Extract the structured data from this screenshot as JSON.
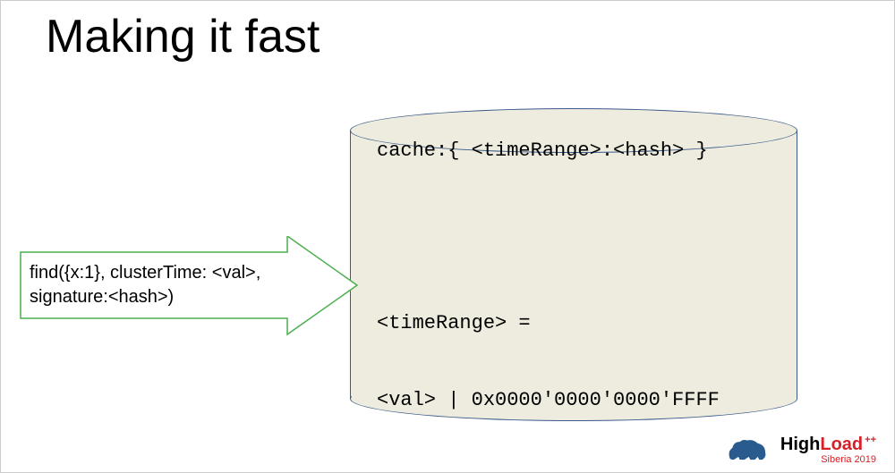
{
  "title": "Making it fast",
  "arrow": {
    "text": "find({x:1}, clusterTime: <val>, signature:<hash>)"
  },
  "cylinder": {
    "top_line": "cache:{ <timeRange>:<hash> }",
    "body_line1": "<timeRange> =",
    "body_line2": "<val> | 0x0000'0000'0000'FFFF"
  },
  "footer": {
    "brand_high": "High",
    "brand_load": "Load",
    "brand_plus": "++",
    "subtitle": "Siberia 2019"
  }
}
